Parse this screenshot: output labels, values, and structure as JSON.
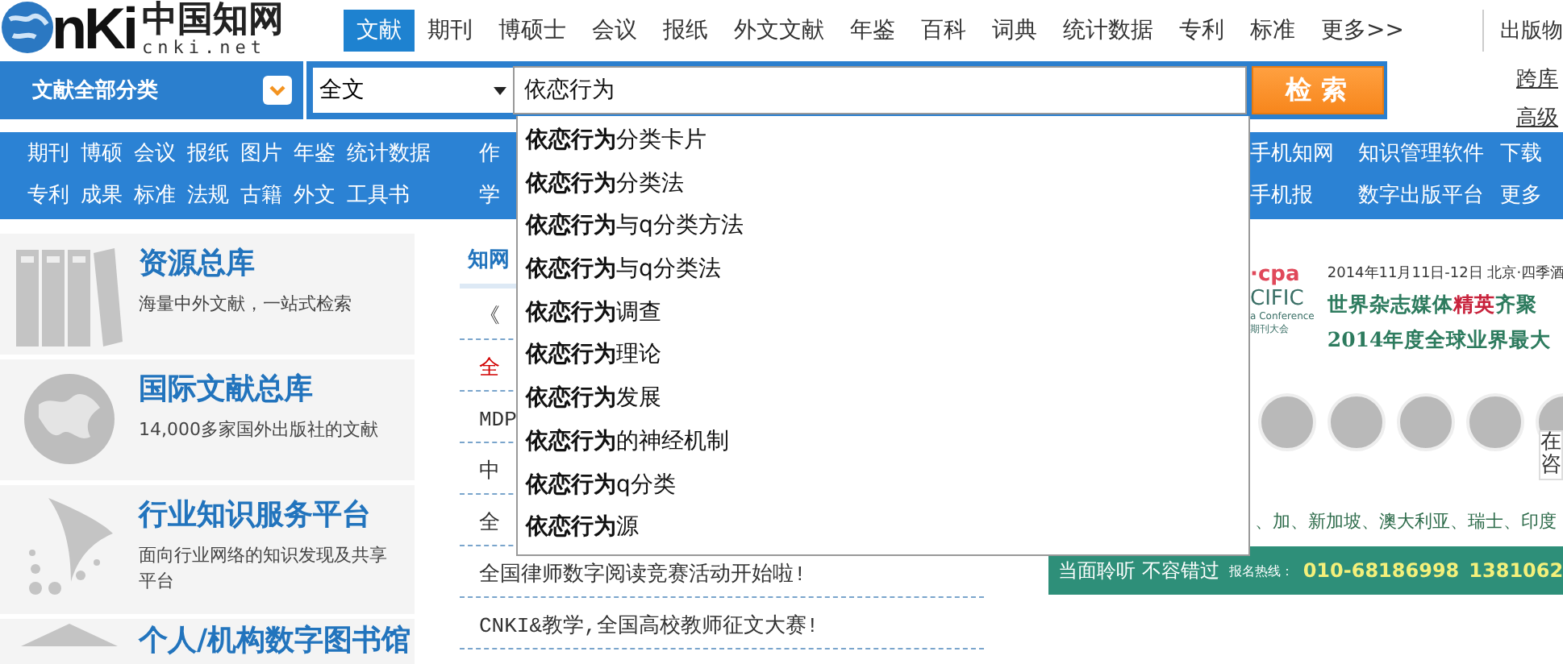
{
  "logo": {
    "mark": "nKi",
    "name": "中国知网",
    "domain": "cnki.net"
  },
  "nav_tabs": [
    {
      "label": "文献",
      "selected": true
    },
    {
      "label": "期刊",
      "selected": false
    },
    {
      "label": "博硕士",
      "selected": false
    },
    {
      "label": "会议",
      "selected": false
    },
    {
      "label": "报纸",
      "selected": false
    },
    {
      "label": "外文文献",
      "selected": false
    },
    {
      "label": "年鉴",
      "selected": false
    },
    {
      "label": "百科",
      "selected": false
    },
    {
      "label": "词典",
      "selected": false
    },
    {
      "label": "统计数据",
      "selected": false
    },
    {
      "label": "专利",
      "selected": false
    },
    {
      "label": "标准",
      "selected": false
    },
    {
      "label": "更多>>",
      "selected": false
    }
  ],
  "header_right_link": "出版物",
  "search": {
    "category": "文献全部分类",
    "field": "全文",
    "value": "依恋行为",
    "button": "检索",
    "side_links": [
      "跨库",
      "高级"
    ]
  },
  "subnav": {
    "left_rows": [
      [
        "期刊",
        "博硕",
        "会议",
        "报纸",
        "图片",
        "年鉴",
        "统计数据"
      ],
      [
        "专利",
        "成果",
        "标准",
        "法规",
        "古籍",
        "外文",
        "工具书"
      ]
    ],
    "partial": [
      "作",
      "学"
    ],
    "right_rows": [
      [
        "手机知网",
        "知识管理软件",
        "下载"
      ],
      [
        "手机报",
        "数字出版平台",
        "更多"
      ]
    ]
  },
  "suggestions": [
    "**依恋行为**分类卡片",
    "**依恋行为**分类法",
    "**依恋行为**与q分类方法",
    "**依恋行为**与q分类法",
    "**依恋行为**调查",
    "**依恋行为**理论",
    "**依恋行为**发展",
    "**依恋行为**的神经机制",
    "**依恋行为**q分类",
    "**依恋行为**源"
  ],
  "resources": [
    {
      "kind": "binders",
      "title": "资源总库",
      "desc": "海量中外文献，一站式检索"
    },
    {
      "kind": "globe",
      "title": "国际文献总库",
      "desc": "14,000多家国外出版社的文献"
    },
    {
      "kind": "swoosh",
      "title": "行业知识服务平台",
      "desc": "面向行业网络的知识发现及共享平台"
    },
    {
      "kind": "house",
      "title": "个人/机构数字图书馆"
    }
  ],
  "news": {
    "heading": "知网",
    "items": [
      {
        "text": "《",
        "highlighted": false
      },
      {
        "text": "全",
        "highlighted": true
      },
      {
        "text": "MDP",
        "highlighted": false
      },
      {
        "text": "中",
        "highlighted": false
      },
      {
        "text": "全",
        "highlighted": false
      },
      {
        "text": "全国律师数字阅读竞赛活动开始啦!",
        "highlighted": false
      },
      {
        "text": "CNKI&教学,全国高校教师征文大赛!",
        "highlighted": false
      }
    ]
  },
  "banner": {
    "brand": "·cpa",
    "brand2": "CIFIC",
    "conference": "a Conference",
    "conference_cn": "期刊大会",
    "date": "2014年11月11日-12日 北京·四季酒",
    "headlines": [
      [
        {
          "text": "世界杂志媒体",
          "accent": false
        },
        {
          "text": "精英",
          "accent": true
        },
        {
          "text": "齐聚",
          "accent": false
        }
      ],
      [
        {
          "text": "2014年度全球业界最大",
          "accent": false
        }
      ]
    ],
    "countries": "、加、新加坡、澳大利亚、瑞士、印度",
    "slogan": "当面聆听 不容错过",
    "hotline_label": "报名热线：",
    "phones": [
      "010-68186998",
      "1381062"
    ],
    "side_widget": "在咨"
  }
}
